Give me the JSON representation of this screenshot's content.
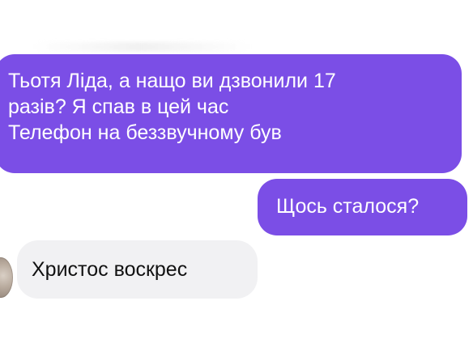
{
  "chat": {
    "colors": {
      "outgoing_bubble": "#7b4ee6",
      "incoming_bubble": "#f1f1f3",
      "background": "#ffffff"
    },
    "messages": [
      {
        "direction": "outgoing",
        "lines": [
          "Тьотя Ліда, а нащо ви дзвонили 17",
          "разів? Я спав в цей час",
          "Телефон на беззвучному був"
        ]
      },
      {
        "direction": "outgoing",
        "text": "Щось сталося?"
      },
      {
        "direction": "incoming",
        "text": "Христос воскрес",
        "avatar_icon": "contact-avatar"
      }
    ]
  }
}
